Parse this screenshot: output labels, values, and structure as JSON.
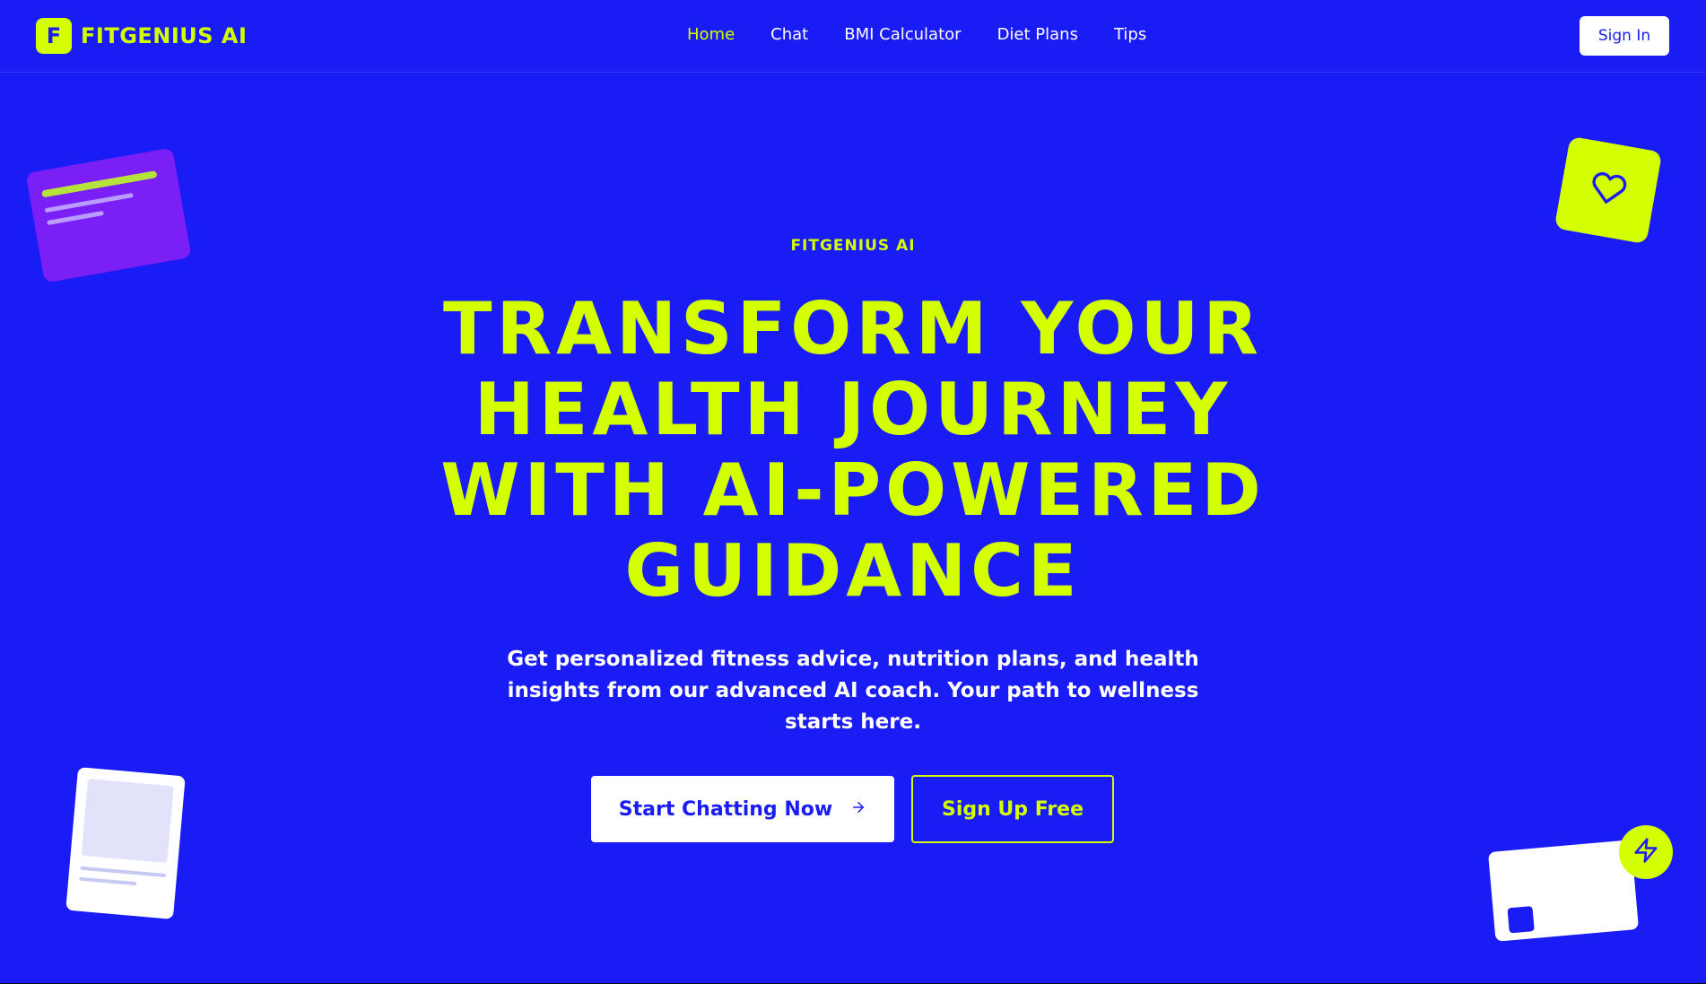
{
  "brand": {
    "logo_letter": "F",
    "name": "FITGENIUS AI"
  },
  "nav": {
    "items": [
      {
        "label": "Home",
        "active": true
      },
      {
        "label": "Chat",
        "active": false
      },
      {
        "label": "BMI Calculator",
        "active": false
      },
      {
        "label": "Diet Plans",
        "active": false
      },
      {
        "label": "Tips",
        "active": false
      }
    ]
  },
  "header": {
    "signin_label": "Sign In"
  },
  "hero": {
    "eyebrow": "FITGENIUS AI",
    "headline_lines": [
      "TRANSFORM YOUR",
      "HEALTH JOURNEY",
      "WITH AI-POWERED",
      "GUIDANCE"
    ],
    "subtext": "Get personalized fitness advice, nutrition plans, and health insights from our advanced AI coach. Your path to wellness starts here.",
    "primary_cta": "Start Chatting Now",
    "secondary_cta": "Sign Up Free"
  },
  "icons": {
    "primary_cta_icon": "arrow-right-icon",
    "heart": "heart-icon",
    "bolt": "lightning-bolt-icon"
  },
  "colors": {
    "background": "#1a1cf5",
    "accent": "#d4ff00",
    "text": "#ffffff",
    "purple_card": "#7b1ff7"
  }
}
